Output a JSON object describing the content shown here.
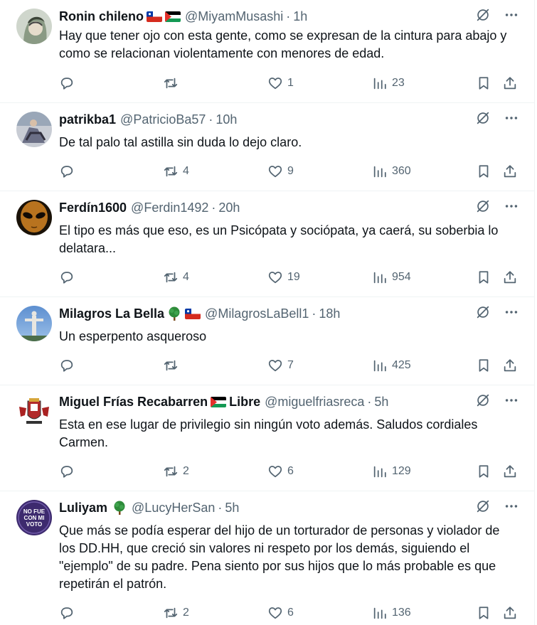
{
  "tweets": [
    {
      "name": "Ronin chileno",
      "handle": "@MiyamMusashi",
      "time": "1h",
      "text": "Hay que tener ojo con esta gente, como se expresan de la cintura para abajo y como se relacionan violentamente con menores de edad.",
      "replies": "",
      "retweets": "",
      "likes": "1",
      "views": "23"
    },
    {
      "name": "patrikba1",
      "handle": "@PatricioBa57",
      "time": "10h",
      "text": "De tal palo tal astilla sin duda lo dejo claro.",
      "replies": "",
      "retweets": "4",
      "likes": "9",
      "views": "360"
    },
    {
      "name": "Ferdín1600",
      "handle": "@Ferdin1492",
      "time": "20h",
      "text": "El tipo es más que eso, es un Psicópata y sociópata, ya caerá, su soberbia lo delatara...",
      "replies": "",
      "retweets": "4",
      "likes": "19",
      "views": "954"
    },
    {
      "name": "Milagros La Bella",
      "handle": "@MilagrosLaBell1",
      "time": "18h",
      "text": "Un esperpento asqueroso",
      "replies": "",
      "retweets": "",
      "likes": "7",
      "views": "425"
    },
    {
      "name": "Miguel Frías Recabarren",
      "name_suffix": "Libre",
      "handle": "@miguelfriasreca",
      "time": "5h",
      "text": "Esta en ese lugar de privilegio sin ningún voto además. Saludos cordiales Carmen.",
      "replies": "",
      "retweets": "2",
      "likes": "6",
      "views": "129"
    },
    {
      "name": "Luliyam",
      "handle": "@LucyHerSan",
      "time": "5h",
      "text": "Que más se podía esperar del hijo de un torturador de personas y violador de los DD.HH, que creció sin valores ni respeto por los demás, siguiendo el \"ejemplo\" de su padre. Pena siento por sus hijos que lo más probable es que repetirán el patrón.",
      "avatar_text": [
        "NO FUE",
        "CON MI",
        "VOTO"
      ],
      "replies": "",
      "retweets": "2",
      "likes": "6",
      "views": "136"
    }
  ],
  "icons": {
    "reply": "reply-icon",
    "retweet": "retweet-icon",
    "like": "heart-icon",
    "views": "views-icon",
    "bookmark": "bookmark-icon",
    "share": "share-icon",
    "grok": "grok-icon",
    "more": "more-icon"
  },
  "colors": {
    "text": "#0f1419",
    "secondary": "#536471",
    "divider": "#eff3f4"
  }
}
